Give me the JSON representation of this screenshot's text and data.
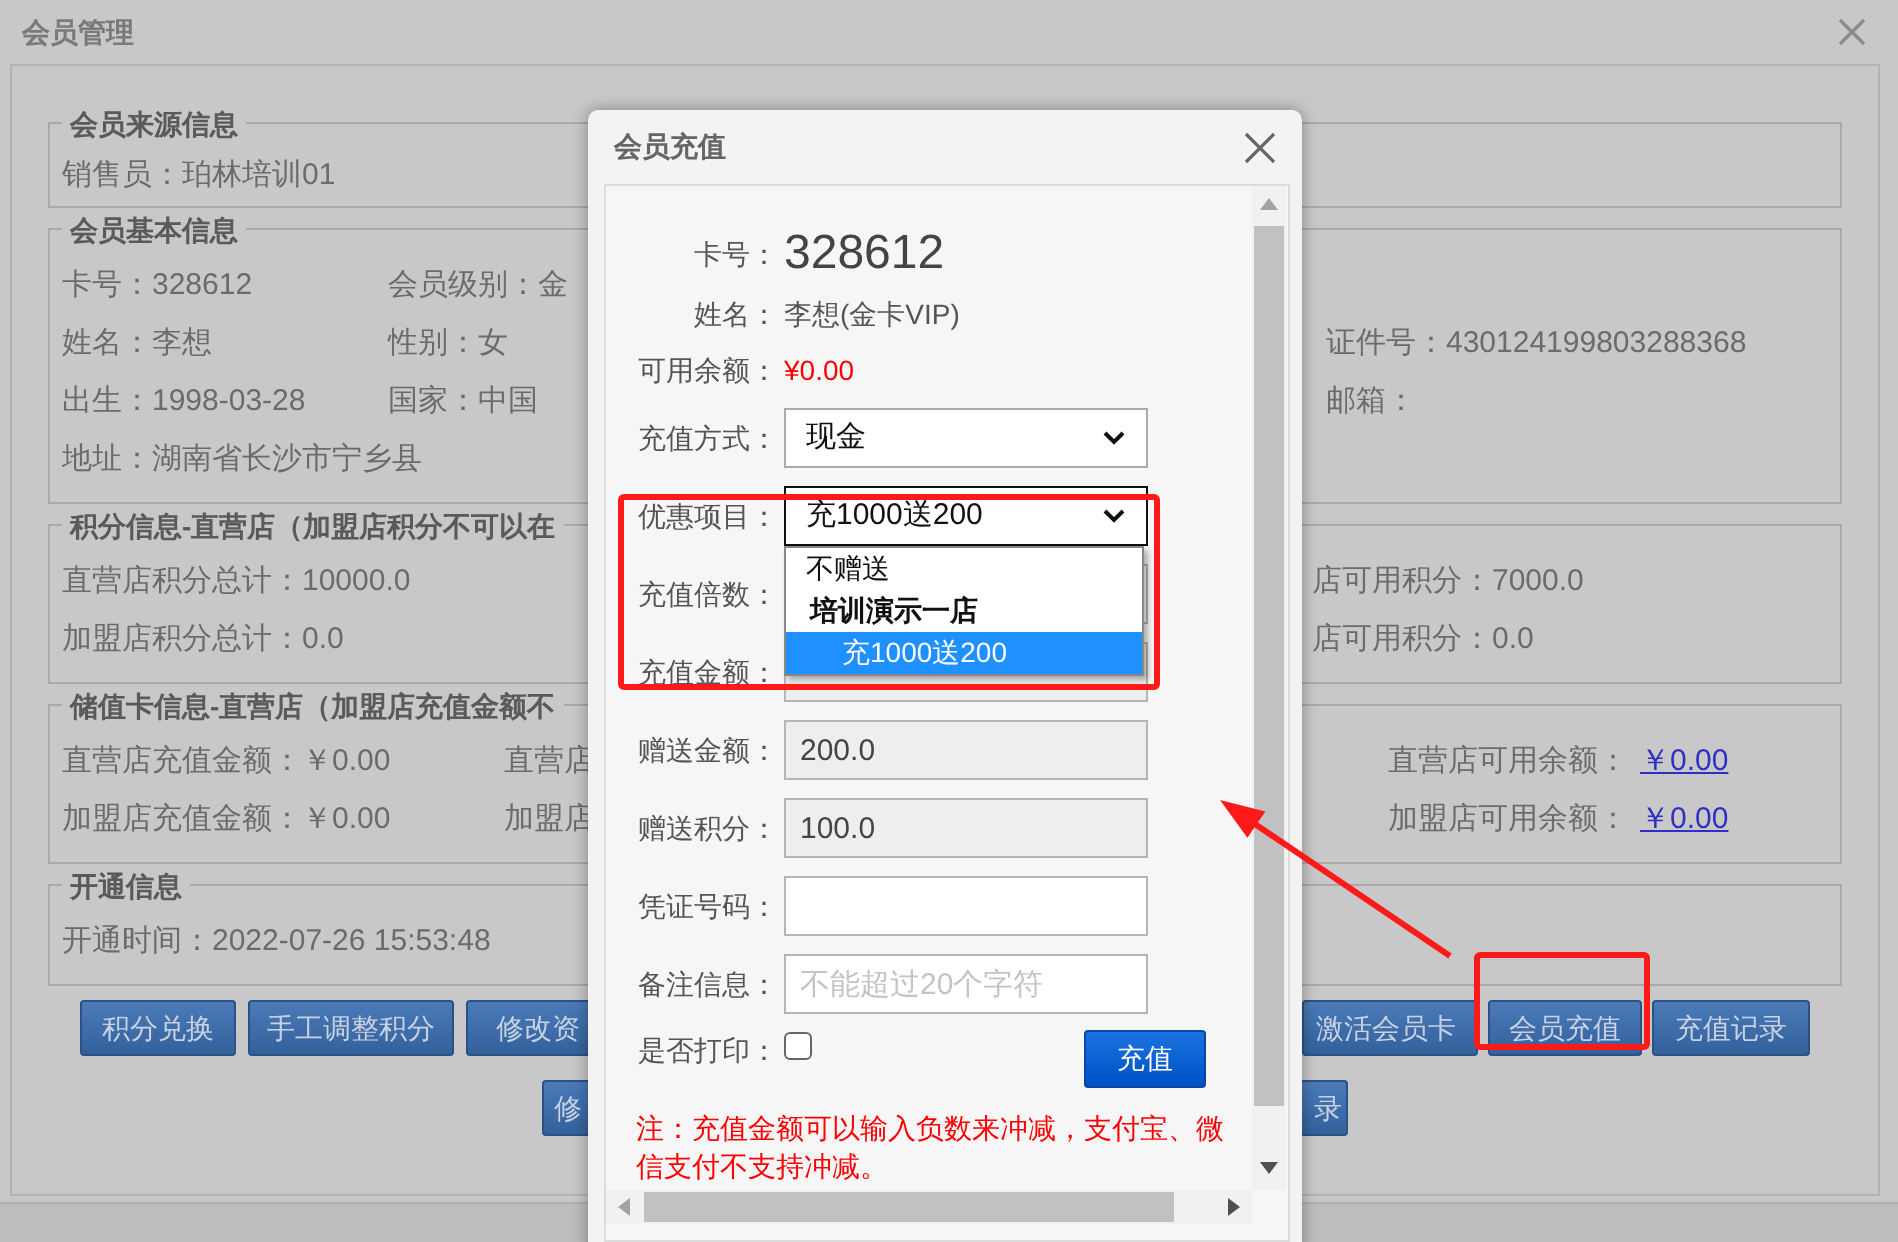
{
  "main_window": {
    "title": "会员管理",
    "sections": [
      {
        "legend": "会员来源信息",
        "rows": [
          {
            "left": [
              {
                "kind": "text",
                "text": "销售员：珀林培训01"
              }
            ],
            "right": []
          }
        ]
      },
      {
        "legend": "会员基本信息",
        "rows": [
          {
            "left": [
              {
                "kind": "text",
                "text": "卡号：328612"
              },
              {
                "kind": "text",
                "text": "会员级别：金"
              }
            ],
            "right": []
          },
          {
            "left": [
              {
                "kind": "text",
                "text": "姓名：李想"
              },
              {
                "kind": "text",
                "text": "性别：女"
              }
            ],
            "right": [
              {
                "kind": "text",
                "text": "证件号：430124199803288368"
              }
            ]
          },
          {
            "left": [
              {
                "kind": "text",
                "text": "出生：1998-03-28"
              },
              {
                "kind": "text",
                "text": "国家：中国"
              }
            ],
            "right": [
              {
                "kind": "text",
                "text": "邮箱："
              }
            ]
          },
          {
            "left": [
              {
                "kind": "text",
                "text": "地址：湖南省长沙市宁乡县"
              }
            ],
            "right": []
          }
        ]
      },
      {
        "legend": "积分信息-直营店（加盟店积分不可以在",
        "rows": [
          {
            "left": [
              {
                "kind": "text",
                "text": "直营店积分总计：10000.0"
              }
            ],
            "right": [
              {
                "kind": "text",
                "text": "店可用积分：7000.0"
              }
            ]
          },
          {
            "left": [
              {
                "kind": "text",
                "text": "加盟店积分总计：0.0"
              }
            ],
            "right": [
              {
                "kind": "text",
                "text": "店可用积分：0.0"
              }
            ]
          }
        ]
      },
      {
        "legend": "储值卡信息-直营店（加盟店充值金额不",
        "rows": [
          {
            "left": [
              {
                "kind": "text",
                "text": "直营店充值金额：￥0.00"
              },
              {
                "kind": "text",
                "text": "直营店"
              }
            ],
            "right": [
              {
                "kind": "link",
                "label": "直营店可用余额：",
                "value": "￥0.00"
              }
            ]
          },
          {
            "left": [
              {
                "kind": "text",
                "text": "加盟店充值金额：￥0.00"
              },
              {
                "kind": "text",
                "text": "加盟店"
              }
            ],
            "right": [
              {
                "kind": "link",
                "label": "加盟店可用余额：",
                "value": "￥0.00"
              }
            ]
          }
        ]
      },
      {
        "legend": "开通信息",
        "rows": [
          {
            "left": [
              {
                "kind": "text",
                "text": "开通时间：2022-07-26 15:53:48"
              }
            ],
            "right": []
          }
        ]
      }
    ],
    "button_rows": [
      {
        "left": [
          "积分兑换",
          "手工调整积分",
          "修改资"
        ],
        "right": [
          "激活会员卡",
          "会员充值",
          "充值记录"
        ]
      },
      {
        "left": [
          "修"
        ],
        "right": [
          "录"
        ]
      }
    ]
  },
  "dialog": {
    "title": "会员充值",
    "card": {
      "label": "卡号：",
      "value": "328612"
    },
    "name": {
      "label": "姓名：",
      "value": "李想(金卡VIP)"
    },
    "balance": {
      "label": "可用余额：",
      "value": "¥0.00"
    },
    "fields": [
      {
        "kind": "select",
        "label": "充值方式：",
        "value": "现金",
        "expanded": false
      },
      {
        "kind": "select",
        "label": "优惠项目：",
        "value": "充1000送200",
        "expanded": true,
        "options": [
          {
            "kind": "option",
            "text": "不赠送",
            "selected": false
          },
          {
            "kind": "group",
            "text": "培训演示一店"
          },
          {
            "kind": "option",
            "text": "充1000送200",
            "selected": true
          }
        ]
      },
      {
        "kind": "input",
        "label": "充值倍数：",
        "disabled": false
      },
      {
        "kind": "input",
        "label": "充值金额：",
        "disabled": true
      },
      {
        "kind": "input",
        "label": "赠送金额：",
        "value": "200.0",
        "disabled": true
      },
      {
        "kind": "input",
        "label": "赠送积分：",
        "value": "100.0",
        "disabled": true
      },
      {
        "kind": "input",
        "label": "凭证号码：",
        "disabled": false
      },
      {
        "kind": "input",
        "label": "备注信息：",
        "placeholder": "不能超过20个字符",
        "disabled": false
      }
    ],
    "print": {
      "label": "是否打印：",
      "checked": false
    },
    "submit": "充值",
    "note": "注：充值金额可以输入负数来冲减，支付宝、微信支付不支持冲减。"
  }
}
